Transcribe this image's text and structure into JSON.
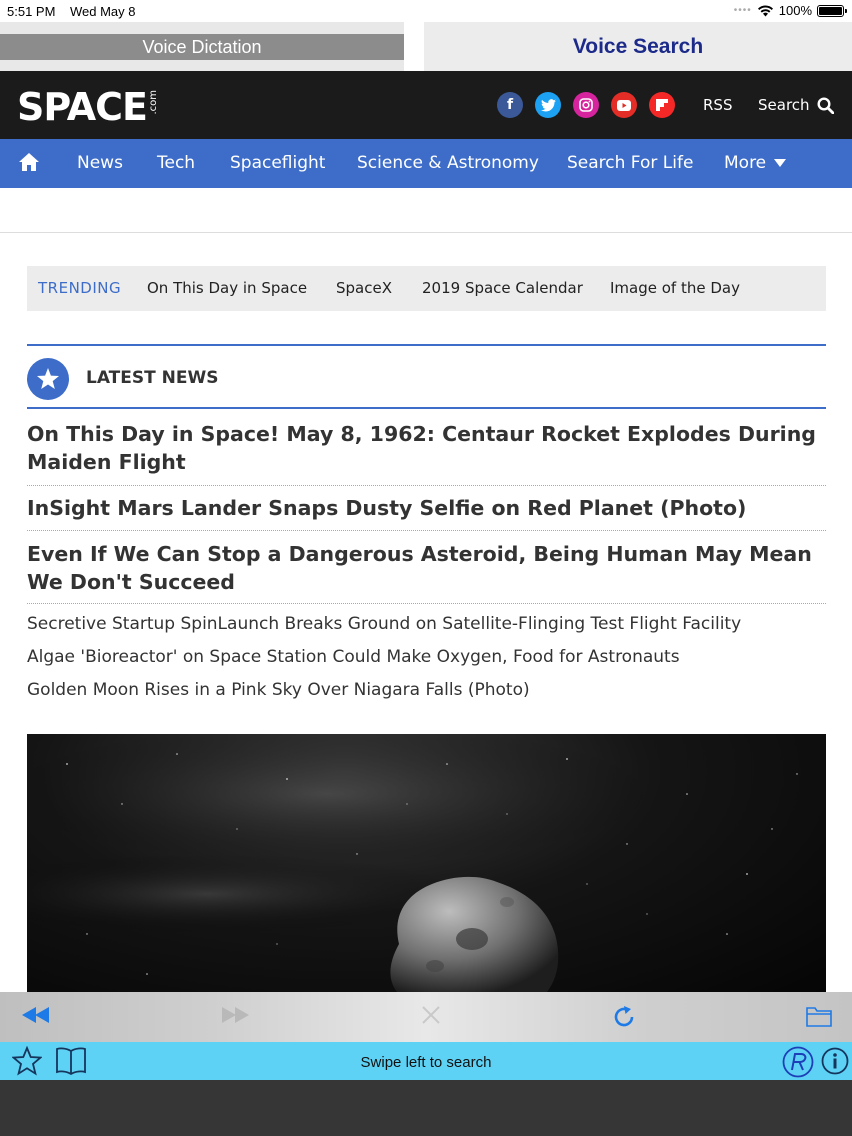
{
  "status": {
    "time": "5:51 PM",
    "date": "Wed May 8",
    "battery": "100%"
  },
  "voice": {
    "dictation": "Voice Dictation",
    "search": "Voice Search"
  },
  "header": {
    "logo": "SPACE",
    "logo_suffix": ".com",
    "socials": [
      "facebook",
      "twitter",
      "instagram",
      "youtube",
      "flipboard"
    ],
    "rss": "RSS",
    "search": "Search"
  },
  "nav": {
    "items": [
      "News",
      "Tech",
      "Spaceflight",
      "Science & Astronomy",
      "Search For Life",
      "More"
    ]
  },
  "trending": {
    "label": "TRENDING",
    "items": [
      "On This Day in Space",
      "SpaceX",
      "2019 Space Calendar",
      "Image of the Day"
    ]
  },
  "latest": {
    "title": "LATEST NEWS",
    "headlines": [
      "On This Day in Space! May 8, 1962: Centaur Rocket Explodes During Maiden Flight",
      "InSight Mars Lander Snaps Dusty Selfie on Red Planet (Photo)",
      "Even If We Can Stop a Dangerous Asteroid, Being Human May Mean We Don't Succeed"
    ],
    "links": [
      "Secretive Startup SpinLaunch Breaks Ground on Satellite-Flinging Test Flight Facility",
      "Algae 'Bioreactor' on Space Station Could Make Oxygen, Food for Astronauts",
      "Golden Moon Rises in a Pink Sky Over Niagara Falls (Photo)"
    ]
  },
  "bottom": {
    "swipe": "Swipe left to search"
  },
  "colors": {
    "brand_blue": "#3d6dc9",
    "header_dark": "#1b1b1b",
    "swipe_bar": "#5ed2f4"
  }
}
